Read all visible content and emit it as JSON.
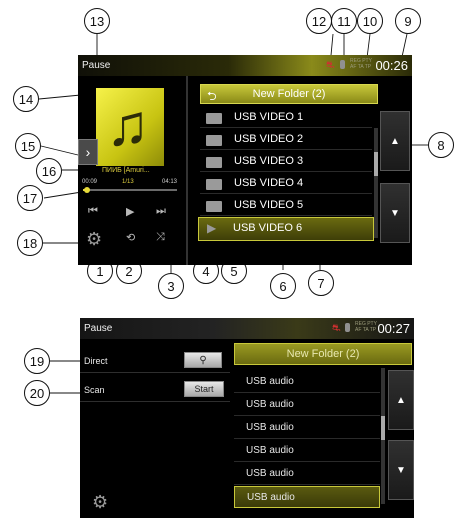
{
  "colors": {
    "accent": "#c8c83a",
    "highlight": "#e0d040",
    "screen_bg": "#000000"
  },
  "callouts": [
    "1",
    "2",
    "3",
    "4",
    "5",
    "6",
    "7",
    "8",
    "9",
    "10",
    "11",
    "12",
    "13",
    "14",
    "15",
    "16",
    "17",
    "18",
    "19",
    "20"
  ],
  "screen1": {
    "status_title": "Pause",
    "time": "00:26",
    "rbd_line1": "REG PTY",
    "rbd_line2": "AF TA TP",
    "icons": {
      "car": "car-icon",
      "bluetooth": "bluetooth-icon",
      "album_art": "music-note-icon",
      "gear": "gear-icon"
    },
    "nav_btn": "›",
    "track_title": "ПИИБ [Amuri...",
    "time_start": "00:09",
    "track_num": "1/13",
    "time_end": "04:13",
    "progress_fraction": 0.04,
    "controls": {
      "prev": "⏮",
      "play": "▶",
      "next": "⏭",
      "repeat": "⟲",
      "shuffle": "⤨"
    },
    "list": {
      "back": "⮌",
      "title": "New Folder (2)",
      "items": [
        "USB VIDEO 1",
        "USB VIDEO 2",
        "USB VIDEO 3",
        "USB VIDEO 4",
        "USB VIDEO 5",
        "USB VIDEO 6"
      ],
      "selected_index": 5,
      "up": "▲",
      "down": "▼"
    }
  },
  "screen2": {
    "status_title": "Pause",
    "time": "00:27",
    "rbd_line1": "REG PTY",
    "rbd_line2": "AF TA TP",
    "direct_label": "Direct",
    "direct_icon": "⚲",
    "scan_label": "Scan",
    "start_label": "Start",
    "list": {
      "title": "New Folder (2)",
      "items": [
        "USB audio",
        "USB audio",
        "USB audio",
        "USB audio",
        "USB audio",
        "USB audio"
      ],
      "selected_index": 5,
      "up": "▲",
      "down": "▼"
    },
    "gear": "⚙"
  }
}
